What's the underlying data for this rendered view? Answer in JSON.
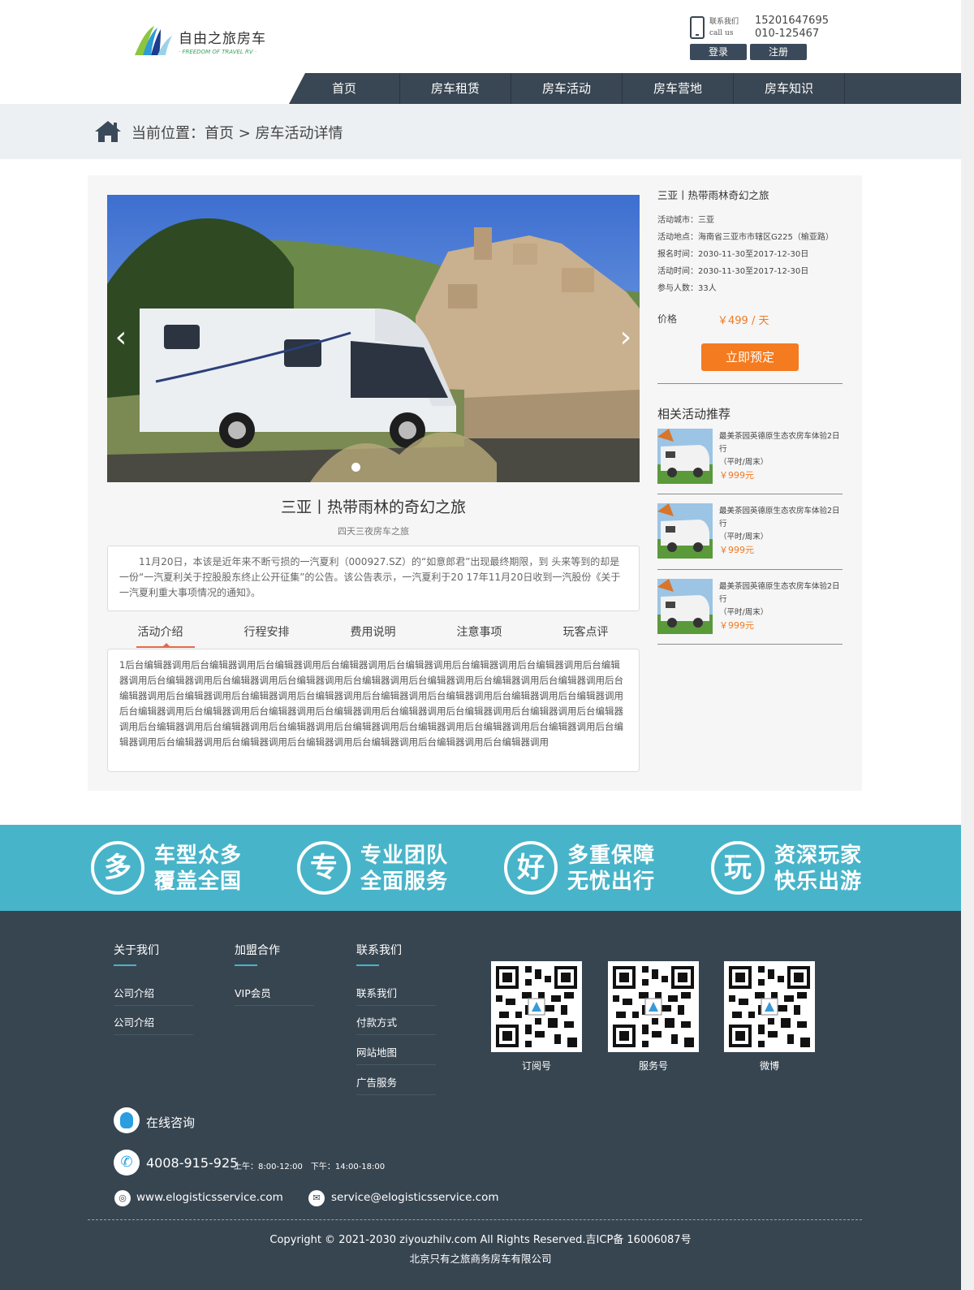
{
  "header": {
    "logo_cn": "自由之旅房车",
    "logo_en": "· FREEDOM OF TRAVEL RV ·",
    "contact_label_cn": "联系我们",
    "contact_label_en": "call us",
    "phone1": "15201647695",
    "phone2": "010-125467",
    "login_label": "登录",
    "register_label": "注册"
  },
  "nav": {
    "items": [
      "首页",
      "房车租赁",
      "房车活动",
      "房车营地",
      "房车知识"
    ]
  },
  "breadcrumb": {
    "text": "当前位置：首页 > 房车活动详情"
  },
  "activity": {
    "title": "三亚丨热带雨林的奇幻之旅",
    "subtitle": "四天三夜房车之旅",
    "intro": "11月20日，本该是近年来不断亏损的一汽夏利（000927.SZ）的“如意郎君”出现最终期限，到 头来等到的却是一份“一汽夏利关于控股股东终止公开征集”的公告。该公告表示，一汽夏利于20 17年11月20日收到一汽股份《关于一汽夏利重大事项情况的通知》。",
    "tabs": [
      "活动介绍",
      "行程安排",
      "费用说明",
      "注意事项",
      "玩客点评"
    ],
    "tab_content": "1后台编辑器调用后台编辑器调用后台编辑器调用后台编辑器调用后台编辑器调用后台编辑器调用后台编辑器调用后台编辑器调用后台编辑器调用后台编辑器调用后台编辑器调用后台编辑器调用后台编辑器调用后台编辑器调用后台编辑器调用后台编辑器调用后台编辑器调用后台编辑器调用后台编辑器调用后台编辑器调用后台编辑器调用后台编辑器调用后台编辑器调用后台编辑器调用后台编辑器调用后台编辑器调用后台编辑器调用后台编辑器调用后台编辑器调用后台编辑器调用后台编辑器调用后台编辑器调用后台编辑器调用后台编辑器调用后台编辑器调用后台编辑器调用后台编辑器调用后台编辑器调用后台编辑器调用后台编辑器调用后台编辑器调用后台编辑器调用后台编辑器调用后台编辑器调用后台编辑器调用"
  },
  "side": {
    "title": "三亚丨热带雨林奇幻之旅",
    "info": [
      "活动城市：三亚",
      "活动地点：海南省三亚市市辖区G225（榆亚路）",
      "报名时间：2030-11-30至2017-12-30日",
      "活动时间：2030-11-30至2017-12-30日",
      "参与人数：33人"
    ],
    "price_label": "价格",
    "price_value": "￥499 / 天",
    "book_label": "立即预定",
    "related_heading": "相关活动推荐",
    "related": [
      {
        "title": "最美茶园英德原生态农房车体验2日行",
        "note": "（平时/周末）",
        "price": "￥999元"
      },
      {
        "title": "最美茶园英德原生态农房车体验2日行",
        "note": "（平时/周末）",
        "price": "￥999元"
      },
      {
        "title": "最美茶园英德原生态农房车体验2日行",
        "note": "（平时/周末）",
        "price": "￥999元"
      }
    ]
  },
  "features": [
    {
      "char": "多",
      "line1": "车型众多",
      "line2": "覆盖全国"
    },
    {
      "char": "专",
      "line1": "专业团队",
      "line2": "全面服务"
    },
    {
      "char": "好",
      "line1": "多重保障",
      "line2": "无忧出行"
    },
    {
      "char": "玩",
      "line1": "资深玩家",
      "line2": "快乐出游"
    }
  ],
  "footer": {
    "col1": {
      "heading": "关于我们",
      "links": [
        "公司介绍",
        "公司介绍"
      ]
    },
    "col2": {
      "heading": "加盟合作",
      "links": [
        "VIP会员"
      ]
    },
    "col3": {
      "heading": "联系我们",
      "links": [
        "联系我们",
        "付款方式",
        "网站地图",
        "广告服务"
      ]
    },
    "qr_labels": [
      "订阅号",
      "服务号",
      "微博"
    ],
    "consult": "在线咨询",
    "tel": "4008-915-925",
    "hours": "上午：8:00-12:00　下午：14:00-18:00",
    "website": "www.elogisticsservice.com",
    "email": "service@elogisticsservice.com",
    "copyright": "Copyright © 2021-2030 ziyouzhilv.com All Rights Reserved.吉ICP备 16006087号",
    "company": "北京只有之旅商务房车有限公司"
  },
  "colors": {
    "nav_bg": "#394653",
    "accent_orange": "#f47b20",
    "feature_band": "#48b4c9",
    "footer_bg": "#374551"
  }
}
